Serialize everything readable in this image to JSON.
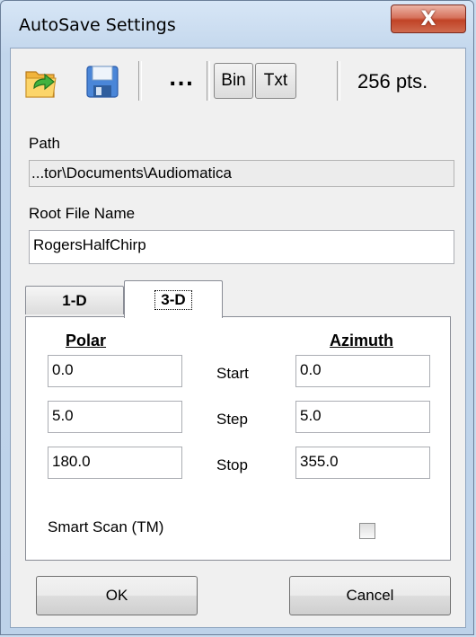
{
  "window": {
    "title": "AutoSave Settings",
    "close_glyph": "X"
  },
  "toolbar": {
    "open_icon": "folder-arrow-icon",
    "save_icon": "floppy-disk-icon",
    "browse_label": "...",
    "bin_label": "Bin",
    "txt_label": "Txt",
    "points_label": "256 pts."
  },
  "path": {
    "label": "Path",
    "value": "...tor\\Documents\\Audiomatica"
  },
  "root_file": {
    "label": "Root File Name",
    "value": "RogersHalfChirp"
  },
  "tabs": [
    {
      "label": "1-D",
      "selected": false
    },
    {
      "label": "3-D",
      "selected": true
    }
  ],
  "panel_3d": {
    "polar_header": "Polar",
    "azimuth_header": "Azimuth",
    "rows": [
      {
        "label": "Start",
        "polar": "0.0",
        "azimuth": "0.0"
      },
      {
        "label": "Step",
        "polar": "5.0",
        "azimuth": "5.0"
      },
      {
        "label": "Stop",
        "polar": "180.0",
        "azimuth": "355.0"
      }
    ],
    "smart_scan_label": "Smart Scan (TM)",
    "smart_scan_checked": false
  },
  "buttons": {
    "ok_label": "OK",
    "cancel_label": "Cancel"
  },
  "colors": {
    "close_button": "#c14326",
    "window_frame": "#bdd2e9",
    "folder_icon": "#e8a430",
    "arrow_icon": "#3fa33f",
    "floppy_icon": "#4a7fd4"
  }
}
